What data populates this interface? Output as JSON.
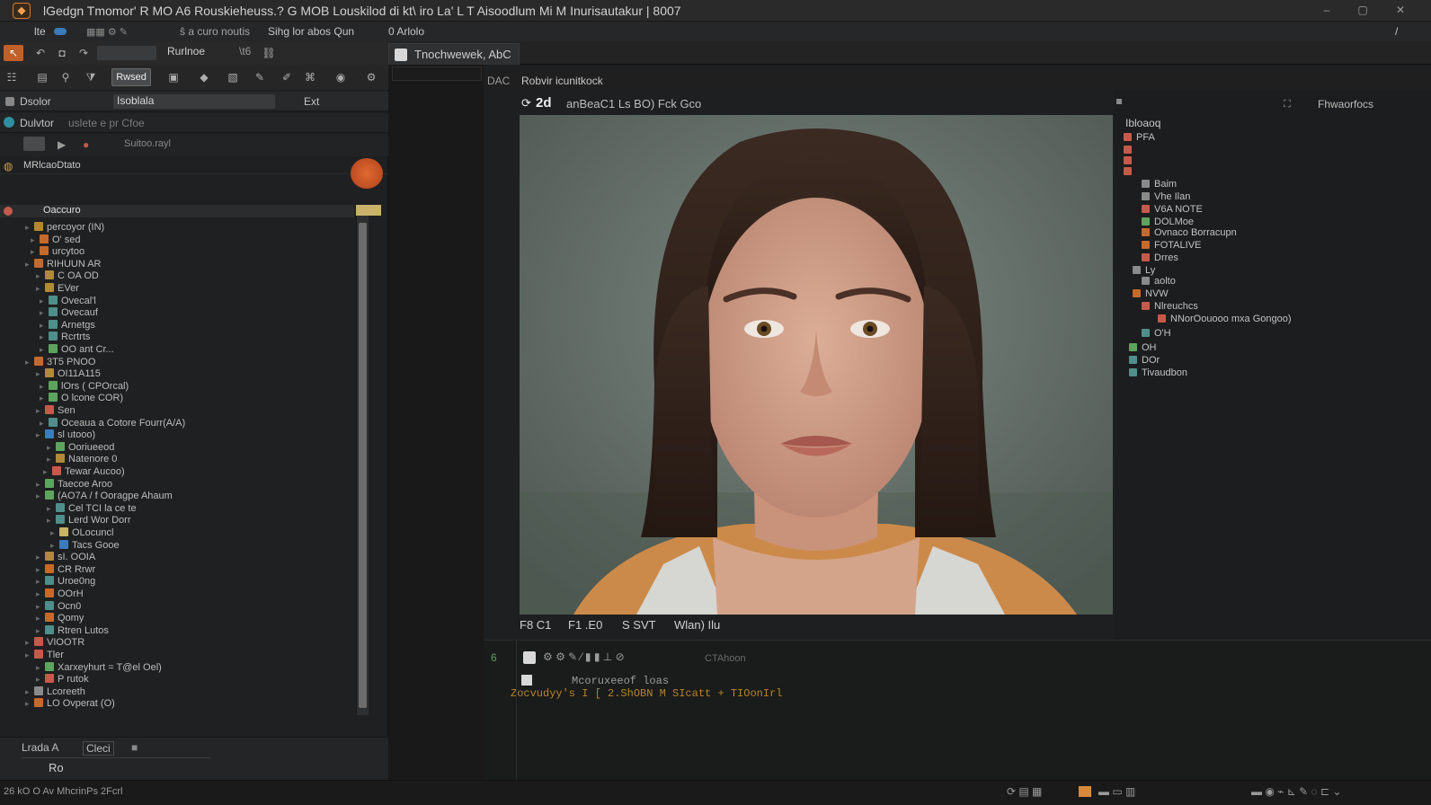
{
  "titlebar": {
    "app_icon": "app-logo-icon",
    "title": "lGedgn Tmomor' R MO A6 Rouskieheuss.? G MOB Louskilod di kt\\ iro La' L T Aisoodlum Mi M Inurisautakur | 8007",
    "buttons": [
      "–",
      "▢",
      "✕"
    ]
  },
  "menubar": {
    "items": [
      "lte",
      "ŝ a curo noutis",
      "Sihg lor abos Qun",
      "0 Arlolo"
    ],
    "right_item": "/"
  },
  "toolbar": {
    "mode_label": "Rwsed",
    "search_text": "Rurlnoe",
    "extra": "\\t6"
  },
  "document_tab": {
    "label": "Tnochwewek, AbC"
  },
  "breadcrumb": {
    "prefix": "DAC",
    "path": "Robvir icunitkock"
  },
  "left_panel": {
    "header_title": "Dsolor",
    "header_field": "Isoblala",
    "header_right": "Ext",
    "section_title": "Dulvtor",
    "section_sub": "uslete e pr Cfoe",
    "row3_label": "Suitoo.rayl",
    "group_title": "MRlcaoDtato",
    "selected_item": "Oaccuro",
    "tree_items": [
      {
        "label": "percoyor (IN)",
        "color": "#b5862e"
      },
      {
        "label": "O' sed",
        "color": "#c66a2c"
      },
      {
        "label": "urcytoo",
        "color": "#c66a2c"
      },
      {
        "label": "RIHUUN AR",
        "color": "#c66a2c"
      },
      {
        "label": "C OA OD",
        "color": "#b08a3a"
      },
      {
        "label": "EVer",
        "color": "#b08a3a"
      },
      {
        "label": "Ovecal'l",
        "color": "#4f8e8a"
      },
      {
        "label": "Ovecauf",
        "color": "#4f8e8a"
      },
      {
        "label": "Arnetgs",
        "color": "#4f8e8a"
      },
      {
        "label": "Rcrtrts",
        "color": "#4f8e8a"
      },
      {
        "label": "OO ant Cr...",
        "color": "#5ea45e"
      },
      {
        "label": "3T5 PNOO",
        "color": "#c66a2c"
      },
      {
        "label": "OI11A115",
        "color": "#b08a3a"
      },
      {
        "label": "lOrs ( CPOrcal)",
        "color": "#5ea45e"
      },
      {
        "label": "O lcone COR)",
        "color": "#5ea45e"
      },
      {
        "label": "Sen",
        "color": "#c65a4a"
      },
      {
        "label": "Oceaua a Cotore Fourr(A/A)",
        "color": "#4f8e8a"
      },
      {
        "label": "sl utooo)",
        "color": "#3d7bbf"
      },
      {
        "label": "Ooriueeod",
        "color": "#5ea45e"
      },
      {
        "label": "Natenore 0",
        "color": "#b08a3a"
      },
      {
        "label": "Tewar Aucoo)",
        "color": "#c65a4a"
      },
      {
        "label": "Taecoe Aroo",
        "color": "#5ea45e"
      },
      {
        "label": "(AO7A / f Ooragpe Ahaum",
        "color": "#5ea45e"
      },
      {
        "label": "Cel TCI la ce te",
        "color": "#4f8e8a"
      },
      {
        "label": "Lerd Wor Dorr",
        "color": "#4f8e8a"
      },
      {
        "label": "OLocuncl",
        "color": "#c9b26a"
      },
      {
        "label": "Tacs Gooe",
        "color": "#3d7bbf"
      },
      {
        "label": "sI. OOIA",
        "color": "#b08a3a"
      },
      {
        "label": "CR Rrwr",
        "color": "#c66a2c"
      },
      {
        "label": "Uroe0ng",
        "color": "#4f8e8a"
      },
      {
        "label": "OOrH",
        "color": "#c66a2c"
      },
      {
        "label": "Ocn0",
        "color": "#4f8e8a"
      },
      {
        "label": "Qomy",
        "color": "#c66a2c"
      },
      {
        "label": "Rtren Lutos",
        "color": "#4f8e8a"
      },
      {
        "label": "VIOOTR",
        "color": "#c65a4a"
      },
      {
        "label": "Tler",
        "color": "#c65a4a"
      },
      {
        "label": "Xarxeyhurt = T@el Oel)",
        "color": "#5ea45e"
      },
      {
        "label": "P rutok",
        "color": "#c65a4a"
      },
      {
        "label": "Lcoreeth",
        "color": "#8a8a8a"
      },
      {
        "label": "LO Ovperat (O)",
        "color": "#c66a2c"
      }
    ],
    "bottom_tab1": "Lrada A",
    "bottom_tab2": "Cleci",
    "bottom_field": "Ro"
  },
  "viewer": {
    "zoom": "2d",
    "header_text": "anBeaC1 Ls BO) Fck Gco",
    "footer_items": [
      "F8 C1",
      "F1 .E0",
      "S SVT",
      "Wlan) Ilu"
    ]
  },
  "right_panel": {
    "header_label": "Fhwaorfocs",
    "root": "Ibloaoq",
    "items": [
      {
        "label": "PFA",
        "color": "#c65a4a"
      },
      {
        "label": "",
        "color": "#c65a4a"
      },
      {
        "label": "",
        "color": "#c65a4a"
      },
      {
        "label": "",
        "color": "#c65a4a"
      },
      {
        "label": "Baim",
        "color": "#8a8a8a"
      },
      {
        "label": "Vhe Ilan",
        "color": "#8a8a8a"
      },
      {
        "label": "V6A NOTE",
        "color": "#c65a4a"
      },
      {
        "label": "DOLMoe",
        "color": "#5ea45e"
      },
      {
        "label": "Ovnaco Borracupn",
        "color": "#c66a2c"
      },
      {
        "label": "FOTALIVE",
        "color": "#c66a2c"
      },
      {
        "label": "Drres",
        "color": "#c65a4a"
      },
      {
        "label": "Ly",
        "color": "#8a8a8a"
      },
      {
        "label": "aolto",
        "color": "#8a8a8a"
      },
      {
        "label": "NVW",
        "color": "#c66a2c"
      },
      {
        "label": "Nlreuchcs",
        "color": "#c65a4a"
      },
      {
        "label": "NNorOouooo mxa Gongoo)",
        "color": "#c65a4a"
      },
      {
        "label": "O'H",
        "color": "#4f8e8a"
      },
      {
        "label": "OH",
        "color": "#5ea45e"
      },
      {
        "label": "DOr",
        "color": "#4f8e8a"
      },
      {
        "label": "Tivaudbon",
        "color": "#4f8e8a"
      }
    ]
  },
  "console": {
    "prompt": "6",
    "toolbar_label": "CTAhoon",
    "line1": "Mcoruxeeof loas",
    "line2": "Zocvudyy's I    [   2.ShOBN M SIcatt + TIOonIrl"
  },
  "statusbar": {
    "text": "26 kO O Av MhcrinPs 2Fcrl"
  },
  "colors": {
    "accent": "#d46a2a",
    "panel_bg": "#1f2021",
    "background": "#1e1f20"
  }
}
